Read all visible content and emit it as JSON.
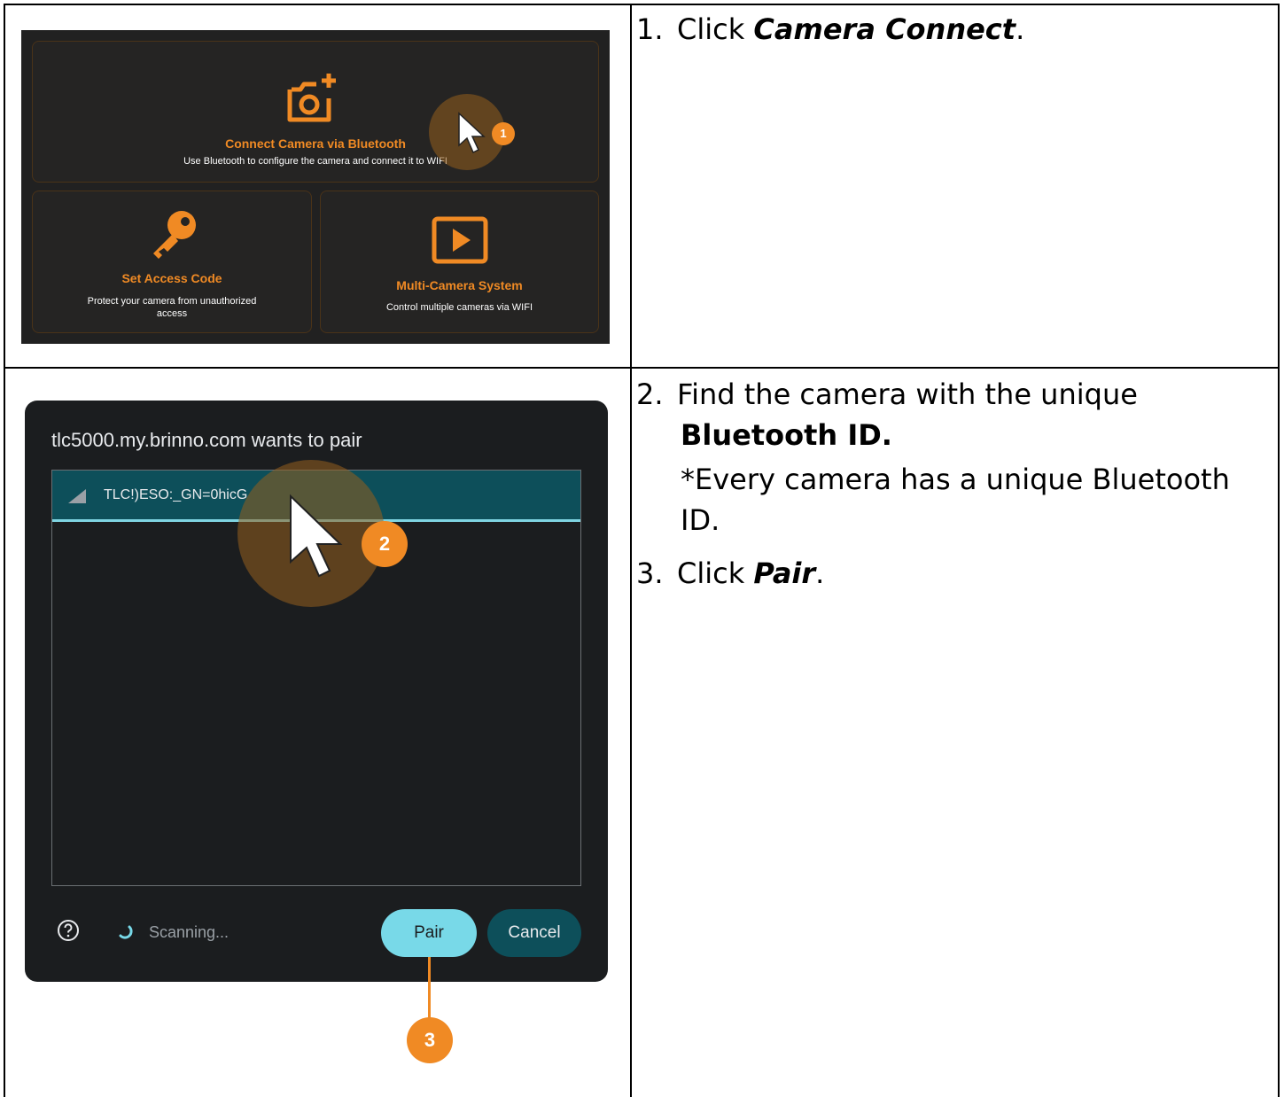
{
  "steps": {
    "step1": {
      "number": "1.",
      "prefix": "Click ",
      "emph": "Camera Connect",
      "suffix": "."
    },
    "step2": {
      "number": "2.",
      "line1": "Find the camera with the unique",
      "line2": "Bluetooth ID.",
      "note1": "*Every camera has a unique Bluetooth",
      "note2": "ID."
    },
    "step3": {
      "number": "3.",
      "prefix": "Click ",
      "emph": "Pair",
      "suffix": "."
    }
  },
  "menu": {
    "connect": {
      "title": "Connect Camera via Bluetooth",
      "desc": "Use Bluetooth to configure the camera and connect it to WIFI",
      "icon": "camera-plus-icon"
    },
    "access": {
      "title": "Set Access Code",
      "desc_line1": "Protect your camera from unauthorized",
      "desc_line2": "access",
      "icon": "key-icon"
    },
    "multi": {
      "title": "Multi-Camera System",
      "desc": "Control multiple cameras via WIFI",
      "icon": "play-box-icon"
    },
    "badge": "1"
  },
  "dialog": {
    "title": "tlc5000.my.brinno.com wants to pair",
    "device": "TLC!)ESO:_GN=0hicG",
    "status": "Scanning...",
    "pair_label": "Pair",
    "cancel_label": "Cancel",
    "badge2": "2",
    "badge3": "3"
  },
  "colors": {
    "accent": "#f08a24",
    "dialog_bg": "#1b1d1f",
    "selected_row": "#0d4f5a",
    "pair_button": "#78d9e8"
  }
}
